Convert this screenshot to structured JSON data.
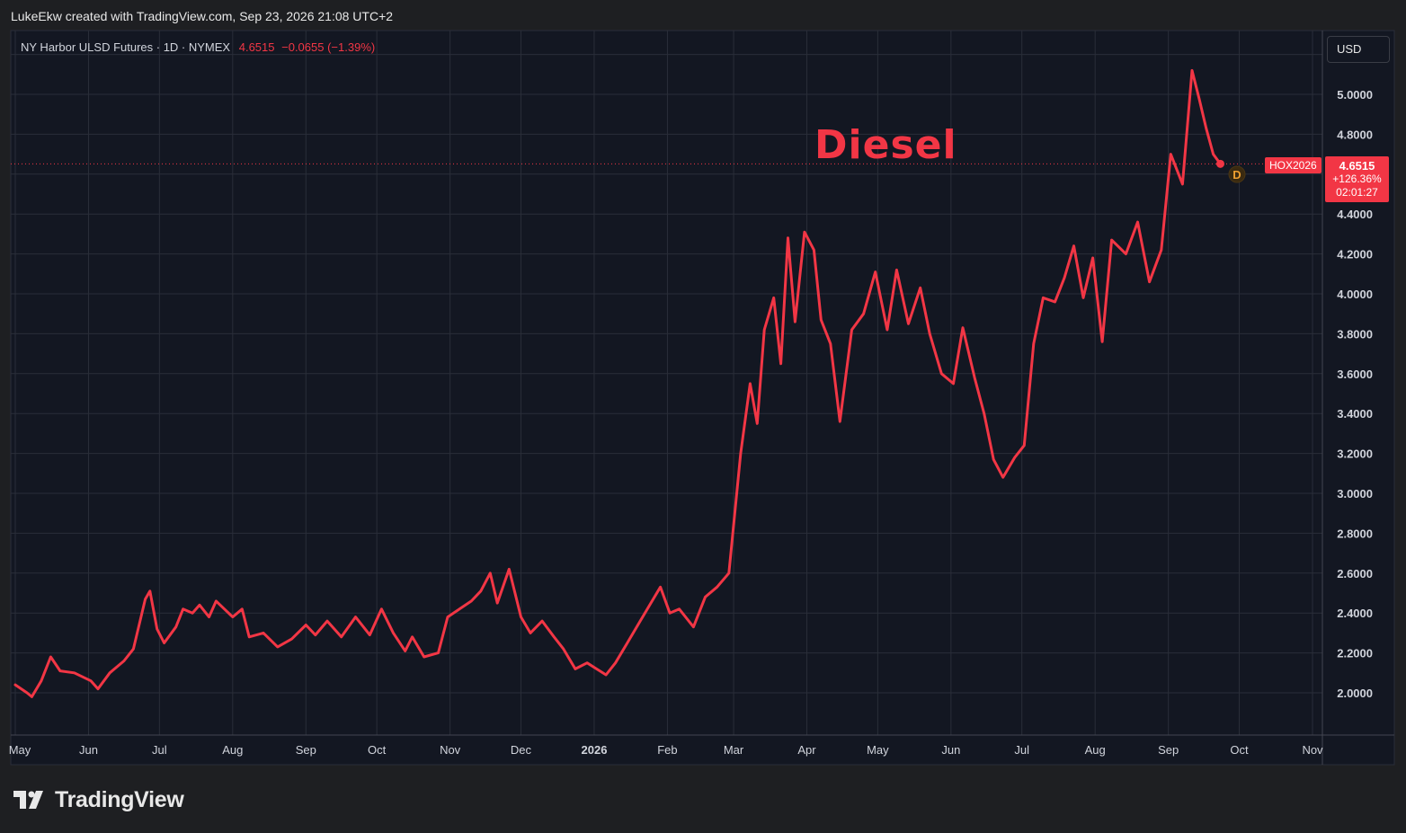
{
  "header": {
    "caption": "LukeEkw created with TradingView.com, Sep 23, 2026 21:08 UTC+2"
  },
  "legend": {
    "symbol": "NY Harbor ULSD Futures · 1D · NYMEX",
    "price": "4.6515",
    "change": "−0.0655 (−1.39%)"
  },
  "currency": "USD",
  "annotation": "Diesel",
  "price_label": {
    "symbol": "HOX2026",
    "price": "4.6515",
    "change_pct": "+126.36%",
    "countdown": "02:01:27"
  },
  "dividend_marker": "D",
  "footer": {
    "logo_text": "TradingView"
  },
  "colors": {
    "background": "#131722",
    "page": "#1e1f22",
    "grid": "#2a2e39",
    "series": "#f23645",
    "text": "#d1d4dc"
  },
  "chart_data": {
    "type": "line",
    "series": [
      {
        "values_note": "daily close approximations",
        "points": [
          [
            "2025-05-01",
            2.04
          ],
          [
            "2025-05-06",
            2.0
          ],
          [
            "2025-05-08",
            1.98
          ],
          [
            "2025-05-12",
            2.06
          ],
          [
            "2025-05-16",
            2.18
          ],
          [
            "2025-05-20",
            2.11
          ],
          [
            "2025-05-26",
            2.1
          ],
          [
            "2025-06-02",
            2.06
          ],
          [
            "2025-06-05",
            2.02
          ],
          [
            "2025-06-10",
            2.1
          ],
          [
            "2025-06-16",
            2.16
          ],
          [
            "2025-06-20",
            2.22
          ],
          [
            "2025-06-25",
            2.47
          ],
          [
            "2025-06-27",
            2.51
          ],
          [
            "2025-06-30",
            2.32
          ],
          [
            "2025-07-03",
            2.25
          ],
          [
            "2025-07-08",
            2.33
          ],
          [
            "2025-07-11",
            2.42
          ],
          [
            "2025-07-15",
            2.4
          ],
          [
            "2025-07-18",
            2.44
          ],
          [
            "2025-07-22",
            2.38
          ],
          [
            "2025-07-25",
            2.46
          ],
          [
            "2025-08-01",
            2.38
          ],
          [
            "2025-08-05",
            2.42
          ],
          [
            "2025-08-08",
            2.28
          ],
          [
            "2025-08-14",
            2.3
          ],
          [
            "2025-08-20",
            2.23
          ],
          [
            "2025-08-26",
            2.27
          ],
          [
            "2025-09-01",
            2.34
          ],
          [
            "2025-09-05",
            2.29
          ],
          [
            "2025-09-10",
            2.36
          ],
          [
            "2025-09-16",
            2.28
          ],
          [
            "2025-09-22",
            2.38
          ],
          [
            "2025-09-28",
            2.29
          ],
          [
            "2025-10-03",
            2.42
          ],
          [
            "2025-10-08",
            2.3
          ],
          [
            "2025-10-13",
            2.21
          ],
          [
            "2025-10-16",
            2.28
          ],
          [
            "2025-10-21",
            2.18
          ],
          [
            "2025-10-27",
            2.2
          ],
          [
            "2025-10-31",
            2.38
          ],
          [
            "2025-11-05",
            2.42
          ],
          [
            "2025-11-10",
            2.46
          ],
          [
            "2025-11-14",
            2.51
          ],
          [
            "2025-11-18",
            2.6
          ],
          [
            "2025-11-21",
            2.45
          ],
          [
            "2025-11-26",
            2.62
          ],
          [
            "2025-12-01",
            2.38
          ],
          [
            "2025-12-05",
            2.3
          ],
          [
            "2025-12-10",
            2.36
          ],
          [
            "2025-12-15",
            2.28
          ],
          [
            "2025-12-19",
            2.22
          ],
          [
            "2025-12-24",
            2.12
          ],
          [
            "2025-12-29",
            2.15
          ],
          [
            "2026-01-02",
            2.12
          ],
          [
            "2026-01-06",
            2.09
          ],
          [
            "2026-01-10",
            2.15
          ],
          [
            "2026-01-15",
            2.25
          ],
          [
            "2026-01-20",
            2.35
          ],
          [
            "2026-01-25",
            2.45
          ],
          [
            "2026-01-29",
            2.53
          ],
          [
            "2026-02-02",
            2.4
          ],
          [
            "2026-02-06",
            2.42
          ],
          [
            "2026-02-12",
            2.33
          ],
          [
            "2026-02-17",
            2.48
          ],
          [
            "2026-02-22",
            2.53
          ],
          [
            "2026-02-27",
            2.6
          ],
          [
            "2026-03-04",
            3.2
          ],
          [
            "2026-03-08",
            3.55
          ],
          [
            "2026-03-11",
            3.35
          ],
          [
            "2026-03-14",
            3.82
          ],
          [
            "2026-03-18",
            3.98
          ],
          [
            "2026-03-21",
            3.65
          ],
          [
            "2026-03-24",
            4.28
          ],
          [
            "2026-03-27",
            3.86
          ],
          [
            "2026-03-31",
            4.31
          ],
          [
            "2026-04-04",
            4.22
          ],
          [
            "2026-04-07",
            3.87
          ],
          [
            "2026-04-11",
            3.75
          ],
          [
            "2026-04-15",
            3.36
          ],
          [
            "2026-04-20",
            3.82
          ],
          [
            "2026-04-25",
            3.9
          ],
          [
            "2026-04-30",
            4.11
          ],
          [
            "2026-05-05",
            3.82
          ],
          [
            "2026-05-09",
            4.12
          ],
          [
            "2026-05-14",
            3.85
          ],
          [
            "2026-05-19",
            4.03
          ],
          [
            "2026-05-23",
            3.8
          ],
          [
            "2026-05-28",
            3.6
          ],
          [
            "2026-06-02",
            3.55
          ],
          [
            "2026-06-06",
            3.83
          ],
          [
            "2026-06-11",
            3.58
          ],
          [
            "2026-06-15",
            3.4
          ],
          [
            "2026-06-19",
            3.17
          ],
          [
            "2026-06-23",
            3.08
          ],
          [
            "2026-06-28",
            3.18
          ],
          [
            "2026-07-02",
            3.24
          ],
          [
            "2026-07-06",
            3.75
          ],
          [
            "2026-07-10",
            3.98
          ],
          [
            "2026-07-15",
            3.96
          ],
          [
            "2026-07-19",
            4.08
          ],
          [
            "2026-07-23",
            4.24
          ],
          [
            "2026-07-27",
            3.98
          ],
          [
            "2026-07-31",
            4.18
          ],
          [
            "2026-08-04",
            3.76
          ],
          [
            "2026-08-08",
            4.27
          ],
          [
            "2026-08-14",
            4.2
          ],
          [
            "2026-08-19",
            4.36
          ],
          [
            "2026-08-24",
            4.06
          ],
          [
            "2026-08-29",
            4.22
          ],
          [
            "2026-09-02",
            4.7
          ],
          [
            "2026-09-07",
            4.55
          ],
          [
            "2026-09-11",
            5.12
          ],
          [
            "2026-09-14",
            4.98
          ],
          [
            "2026-09-17",
            4.83
          ],
          [
            "2026-09-20",
            4.7
          ],
          [
            "2026-09-23",
            4.6515
          ]
        ]
      }
    ],
    "x_ticks": [
      "May",
      "Jun",
      "Jul",
      "Aug",
      "Sep",
      "Oct",
      "Nov",
      "Dec",
      "2026",
      "Feb",
      "Mar",
      "Apr",
      "May",
      "Jun",
      "Jul",
      "Aug",
      "Sep",
      "Oct",
      "Nov"
    ],
    "y_ticks": [
      "2.0000",
      "2.2000",
      "2.4000",
      "2.6000",
      "2.8000",
      "3.0000",
      "3.2000",
      "3.4000",
      "3.6000",
      "3.8000",
      "4.0000",
      "4.2000",
      "4.4000",
      "4.8000",
      "5.0000"
    ],
    "ylim": [
      1.8,
      5.4
    ],
    "xlim": [
      "2025-05-01",
      "2026-11-01"
    ],
    "grid": true,
    "last_value": 4.6515
  }
}
